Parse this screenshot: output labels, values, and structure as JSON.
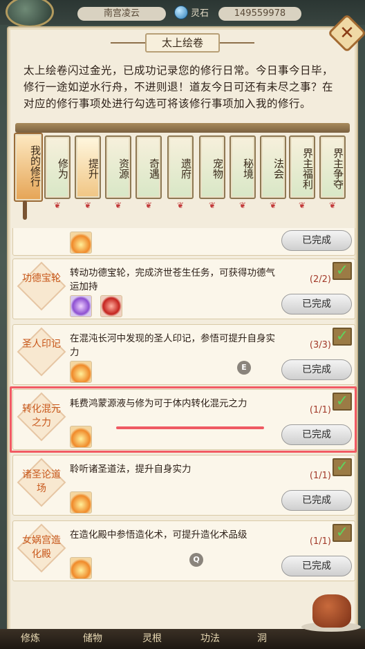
{
  "status": {
    "player_name": "南宫凌云",
    "currency_label": "灵石",
    "currency_value": "149559978"
  },
  "panel": {
    "title": "太上绘卷",
    "close_symbol": "✕",
    "intro": "太上绘卷闪过金光，已成功记录您的修行日常。今日事今日毕，修行一途如逆水行舟，不进则退！道友今日可还有未尽之事？在对应的修行事项处进行勾选可将该修行事项加入我的修行。"
  },
  "tabs": [
    {
      "label": "我的修行"
    },
    {
      "label": "修为"
    },
    {
      "label": "提升"
    },
    {
      "label": "资源"
    },
    {
      "label": "奇遇"
    },
    {
      "label": "遗府"
    },
    {
      "label": "宠物"
    },
    {
      "label": "秘境"
    },
    {
      "label": "法会"
    },
    {
      "label": "界主福利"
    },
    {
      "label": "界主争夺"
    }
  ],
  "items": [
    {
      "name": "",
      "desc": "",
      "progress": "",
      "done": "已完成"
    },
    {
      "name": "功德宝轮",
      "desc": "转动功德宝轮，完成济世苍生任务，可获得功德气运加持",
      "progress": "(2/2)",
      "done": "已完成"
    },
    {
      "name": "圣人印记",
      "desc": "在混沌长河中发现的圣人印记，参悟可提升自身实力",
      "progress": "(3/3)",
      "done": "已完成"
    },
    {
      "name": "转化混元之力",
      "desc": "耗费鸿蒙源液与修为可于体内转化混元之力",
      "progress": "(1/1)",
      "done": "已完成"
    },
    {
      "name": "诸圣论道场",
      "desc": "聆听诸圣道法，提升自身实力",
      "progress": "(1/1)",
      "done": "已完成"
    },
    {
      "name": "女娲宫造化殿",
      "desc": "在造化殿中参悟造化术，可提升造化术品级",
      "progress": "(1/1)",
      "done": "已完成"
    }
  ],
  "markers": {
    "e": "E",
    "q": "Q"
  },
  "check_symbol": "✓",
  "bottom_nav": [
    {
      "label": "修炼"
    },
    {
      "label": "储物"
    },
    {
      "label": "灵根"
    },
    {
      "label": "功法"
    },
    {
      "label": "洞"
    }
  ]
}
